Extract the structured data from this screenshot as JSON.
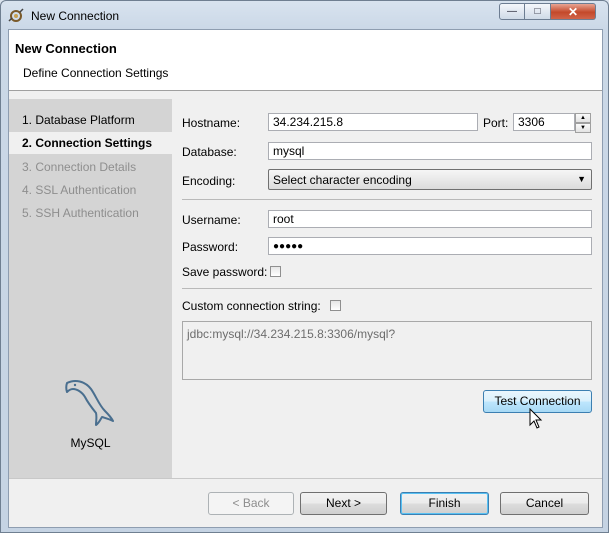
{
  "window": {
    "title": "New Connection",
    "minimize_glyph": "—",
    "maximize_glyph": "□",
    "close_glyph": "✕"
  },
  "header": {
    "title": "New Connection",
    "subtitle": "Define Connection Settings"
  },
  "nav": {
    "items": [
      {
        "label": "1. Database Platform",
        "state": "done"
      },
      {
        "label": "2. Connection Settings",
        "state": "active"
      },
      {
        "label": "3. Connection Details",
        "state": "disabled"
      },
      {
        "label": "4. SSL Authentication",
        "state": "disabled"
      },
      {
        "label": "5. SSH Authentication",
        "state": "disabled"
      }
    ],
    "platform_label": "MySQL",
    "platform_icon": "mysql-dolphin-icon"
  },
  "form": {
    "hostname_label": "Hostname:",
    "hostname_value": "34.234.215.8",
    "port_label": "Port:",
    "port_value": "3306",
    "database_label": "Database:",
    "database_value": "mysql",
    "encoding_label": "Encoding:",
    "encoding_value": "Select character encoding",
    "username_label": "Username:",
    "username_value": "root",
    "password_label": "Password:",
    "password_value": "●●●●●",
    "save_password_label": "Save password:",
    "save_password_checked": false,
    "custom_string_label": "Custom connection string:",
    "custom_string_checked": false,
    "connection_string": "jdbc:mysql://34.234.215.8:3306/mysql?",
    "test_button": "Test Connection"
  },
  "footer": {
    "back": "< Back",
    "next": "Next >",
    "finish": "Finish",
    "cancel": "Cancel"
  },
  "colors": {
    "accent_border": "#3c7fb1",
    "nav_bg": "#d4d4d4",
    "disabled_text": "#8e8e8e"
  }
}
